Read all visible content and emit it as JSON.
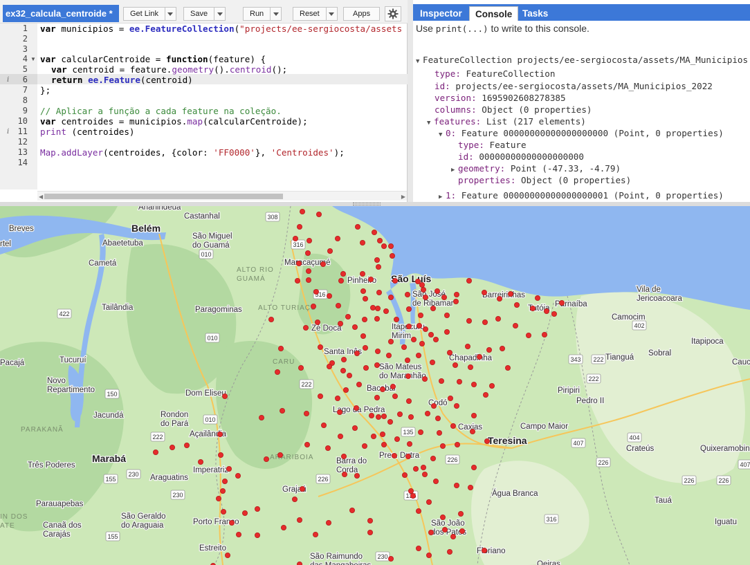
{
  "editor": {
    "script_name": "ex32_calcula_centroide *",
    "buttons": {
      "get_link": "Get Link",
      "save": "Save",
      "run": "Run",
      "reset": "Reset",
      "apps": "Apps"
    },
    "line_numbers": [
      "1",
      "2",
      "3",
      "4",
      "5",
      "6",
      "7",
      "8",
      "9",
      "10",
      "11",
      "12",
      "13",
      "14"
    ],
    "code": {
      "l1_kw": "var",
      "l1_a": " municipios = ",
      "l1_ee": "ee.FeatureCollection",
      "l1_b": "(",
      "l1_str": "\"projects/ee-sergiocosta/assets",
      "l4_kw": "var",
      "l4_a": " calcularCentroide = ",
      "l4_kw2": "function",
      "l4_b": "(feature) {",
      "l5_kw": "var",
      "l5_a": " centroid = feature.",
      "l5_fn": "geometry",
      "l5_b": "().",
      "l5_fn2": "centroid",
      "l5_c": "();",
      "l6_kw": "return",
      "l6_ee": " ee.Feature",
      "l6_a": "(centroid)",
      "l7": "};",
      "l9_cm": "// Aplicar a função a cada feature na coleção.",
      "l10_kw": "var",
      "l10_a": " centroides = municipios.",
      "l10_fn": "map",
      "l10_b": "(calcularCentroide);",
      "l11_fn": "print",
      "l11_a": " (centroides)",
      "l13_fn": "Map.addLayer",
      "l13_a": "(centroides, {color: ",
      "l13_str": "'FF0000'",
      "l13_b": "}, ",
      "l13_str2": "'Centroides'",
      "l13_c": ");"
    }
  },
  "console": {
    "tabs": [
      "Inspector",
      "Console",
      "Tasks"
    ],
    "hint_a": "Use ",
    "hint_code": "print(...)",
    "hint_b": " to write to this console.",
    "fc_header": "FeatureCollection projects/ee-sergiocosta/assets/MA_Municipios",
    "type_key": "type:",
    "type_val": " FeatureCollection",
    "id_key": "id:",
    "id_val": " projects/ee-sergiocosta/assets/MA_Municipios_2022",
    "version_key": "version:",
    "version_val": " 1695902608278385",
    "columns_key": "columns:",
    "columns_val": " Object (0 properties)",
    "features_key": "features:",
    "features_val": " List (217 elements)",
    "f0_key": "0:",
    "f0_val": " Feature 00000000000000000000 (Point, 0 properties)",
    "f0_type_key": "type:",
    "f0_type_val": " Feature",
    "f0_id_key": "id:",
    "f0_id_val": " 00000000000000000000",
    "f0_geom_key": "geometry:",
    "f0_geom_val": " Point (-47.33, -4.79)",
    "f0_props_key": "properties:",
    "f0_props_val": " Object (0 properties)",
    "f1_key": "1:",
    "f1_val": " Feature 00000000000000000001 (Point, 0 properties)"
  },
  "map": {
    "colors": {
      "land": "#cde8b8",
      "forest": "#a9d39b",
      "water": "#8fb7f0",
      "dots": "#e52b2b"
    },
    "places": {
      "belem": "Belém",
      "saoluis": "São Luís",
      "teresina": "Teresina",
      "maraba": "Marabá",
      "ananindeua": "Ananindeua",
      "castanhal": "Castanhal",
      "breves": "Breves",
      "ortel": "rtel",
      "abaetetuba": "Abaetetuba",
      "saomiguel": "São Miguel\ndo Guamá",
      "cameta": "Cametá",
      "tailandia": "Tailândia",
      "pacaja": "Pacajá",
      "tucurui": "Tucuruí",
      "novorep": "Novo\nRepartimento",
      "jacunda": "Jacundá",
      "paragominas": "Paragominas",
      "domeliseu": "Dom Eliseu",
      "rondon": "Rondon\ndo Pará",
      "acailandia": "Açailândia",
      "tres": "Três Poderes",
      "imperatriz": "Imperatriz",
      "araguatins": "Araguatins",
      "parauapebas": "Parauapebas",
      "canaa": "Canaã dos\nCarajás",
      "saogeraldo": "São Geraldo\ndo Araguaia",
      "portofranco": "Porto Franco",
      "estreito": "Estreito",
      "saoraimundo": "São Raimundo\ndas Mangabeiras",
      "maracacume": "Maracaçumé",
      "pinheiro": "Pinheiro",
      "saojose": "São José\nde Ribamar",
      "barreirinhas": "Barreirinhas",
      "tutoia": "Tutóia",
      "parnaiba": "Parnaíba",
      "jericoacoara": "Vila de\nJericoacoara",
      "camocim": "Camocim",
      "itapipoca": "Itapipoca",
      "tiangua": "Tianguá",
      "sobral": "Sobral",
      "cauc": "Cauc",
      "zedoca": "Zé Doca",
      "itapecuru": "Itapecuru\nMirim",
      "santaines": "Santa Inês",
      "saomateus": "São Mateus\ndo Maranhão",
      "chapadinha": "Chapadinha",
      "bacabal": "Bacabal",
      "piripiri": "Piripiri",
      "pedroii": "Pedro II",
      "codo": "Codó",
      "lagodapedra": "Lago da Pedra",
      "caxias": "Caxias",
      "campomaior": "Campo Maior",
      "crateus": "Crateús",
      "quixeramobim": "Quixeramobin",
      "presdutra": "Pres. Dutra",
      "barradocorda": "Barra do\nCorda",
      "grajau": "Grajaú",
      "aguabranca": "Água Branca",
      "taua": "Tauá",
      "iguatu": "Iguatu",
      "saojoao": "São João\ndos Patos",
      "floriano": "Floriano",
      "oeiras": "Oeiras",
      "region_altorio": "ALTO RIO\nGUAMÁ",
      "region_altoturi": "ALTO TURIAÇU",
      "region_caru": "CARU",
      "region_arariboia": "ARARIBOIA",
      "region_parakana": "PARAKANÃ",
      "region_indios": "IN DOS\nATE"
    },
    "shields": [
      "308",
      "316",
      "010",
      "316",
      "422",
      "010",
      "222",
      "150",
      "010",
      "222",
      "230",
      "155",
      "230",
      "155",
      "222",
      "226",
      "135",
      "135",
      "226",
      "402",
      "343",
      "222",
      "407",
      "404",
      "226",
      "226",
      "316",
      "407",
      "230",
      "226"
    ]
  }
}
